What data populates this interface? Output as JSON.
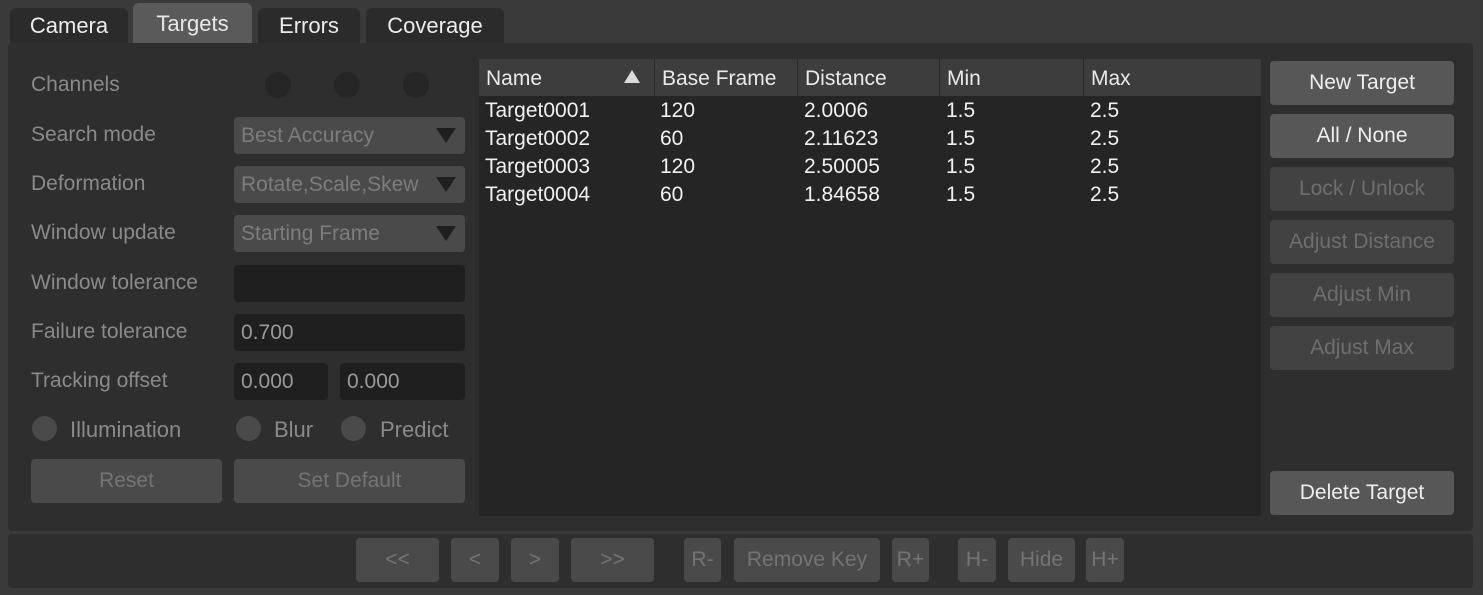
{
  "tabs": [
    {
      "label": "Camera"
    },
    {
      "label": "Targets"
    },
    {
      "label": "Errors"
    },
    {
      "label": "Coverage"
    }
  ],
  "settings": {
    "channels_label": "Channels",
    "search_mode_label": "Search mode",
    "search_mode_value": "Best Accuracy",
    "deformation_label": "Deformation",
    "deformation_value": "Rotate,Scale,Skew",
    "window_update_label": "Window update",
    "window_update_value": "Starting Frame",
    "window_tolerance_label": "Window tolerance",
    "window_tolerance_value": "",
    "failure_tolerance_label": "Failure tolerance",
    "failure_tolerance_value": "0.700",
    "tracking_offset_label": "Tracking offset",
    "tracking_offset_x": "0.000",
    "tracking_offset_y": "0.000",
    "illumination_label": "Illumination",
    "blur_label": "Blur",
    "predict_label": "Predict",
    "reset_label": "Reset",
    "set_default_label": "Set Default"
  },
  "table": {
    "columns": [
      "Name",
      "Base Frame",
      "Distance",
      "Min",
      "Max"
    ],
    "sort_column": "Name",
    "rows": [
      [
        "Target0001",
        "120",
        "2.0006",
        "1.5",
        "2.5"
      ],
      [
        "Target0002",
        "60",
        "2.11623",
        "1.5",
        "2.5"
      ],
      [
        "Target0003",
        "120",
        "2.50005",
        "1.5",
        "2.5"
      ],
      [
        "Target0004",
        "60",
        "1.84658",
        "1.5",
        "2.5"
      ]
    ]
  },
  "actions": {
    "new_target": "New Target",
    "all_none": "All / None",
    "lock_unlock": "Lock / Unlock",
    "adjust_distance": "Adjust Distance",
    "adjust_min": "Adjust Min",
    "adjust_max": "Adjust Max",
    "delete_target": "Delete Target"
  },
  "nav": {
    "first": "<<",
    "prev": "<",
    "next": ">",
    "last": ">>",
    "r_minus": "R-",
    "remove_key": "Remove Key",
    "r_plus": "R+",
    "h_minus": "H-",
    "hide": "Hide",
    "h_plus": "H+"
  },
  "colors": {
    "background": "#3a3a3a",
    "panel": "#2e2e2e",
    "active_tab": "#5a5a5a",
    "table_bg": "#252525"
  }
}
